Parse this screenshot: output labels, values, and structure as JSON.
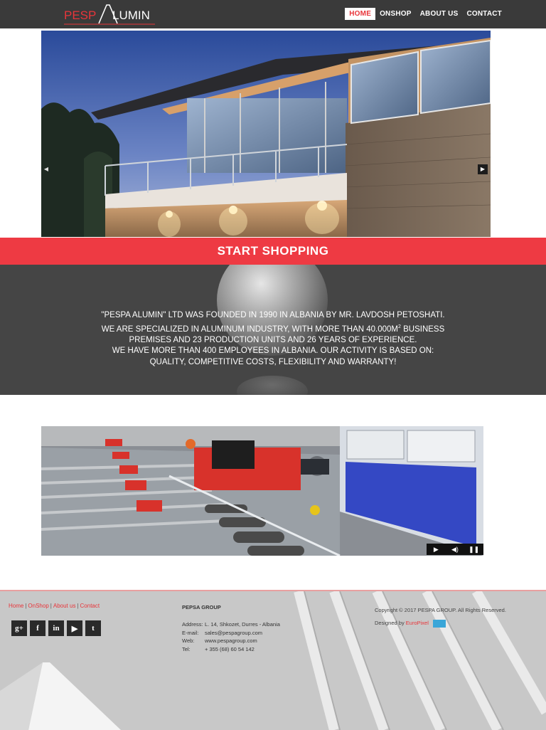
{
  "header": {
    "logo_left": "PESP",
    "logo_right": "LUMIN",
    "nav": [
      "HOME",
      "ONSHOP",
      "ABOUT US",
      "CONTACT"
    ],
    "active_nav": "HOME"
  },
  "hero": {
    "prev_icon": "chevron-left-icon",
    "next_icon": "chevron-right-icon"
  },
  "shop": {
    "label": "START SHOPPING"
  },
  "about": {
    "lines": [
      "\"PESPA ALUMIN\" LTD WAS FOUNDED IN 1990 IN ALBANIA BY MR. LAVDOSH PETOSHATI.",
      "WE ARE SPECIALIZED IN ALUMINUM INDUSTRY, WITH MORE THAN 40.000M",
      "2",
      " BUSINESS",
      "PREMISES AND 23 PRODUCTION UNITS AND 26 YEARS OF EXPERIENCE.",
      "WE HAVE MORE THAN 400 EMPLOYEES IN ALBANIA. OUR ACTIVITY IS BASED ON:",
      "QUALITY, COMPETITIVE COSTS, FLEXIBILITY AND WARRANTY!"
    ]
  },
  "video": {
    "controls": [
      "play-icon",
      "volume-icon",
      "pause-icon"
    ]
  },
  "footer": {
    "links": [
      "Home",
      "OnShop",
      "About us",
      "Contact"
    ],
    "social": [
      {
        "icon": "google-plus-icon",
        "glyph": "g+"
      },
      {
        "icon": "facebook-icon",
        "glyph": "f"
      },
      {
        "icon": "linkedin-icon",
        "glyph": "in"
      },
      {
        "icon": "youtube-icon",
        "glyph": "▶"
      },
      {
        "icon": "twitter-icon",
        "glyph": "t"
      }
    ],
    "company": {
      "title": "PEPSA GROUP",
      "rows": [
        {
          "k": "Address:",
          "v": "L. 14, Shkozet, Durres - Albania"
        },
        {
          "k": "E-mail:",
          "v": "sales@pespagroup.com"
        },
        {
          "k": "Web:",
          "v": "www.pespagroup.com"
        },
        {
          "k": "Tel:",
          "v": "+ 355 (68) 60 54 142"
        }
      ]
    },
    "copyright": "Copyright © 2017 PESPA GROUP. All Rights Reserved.",
    "designed_by": "Designed by",
    "designer": "EuroPixel"
  },
  "colors": {
    "accent": "#ee3a43",
    "header_bg": "#3a3a3a",
    "about_bg": "#454545"
  }
}
